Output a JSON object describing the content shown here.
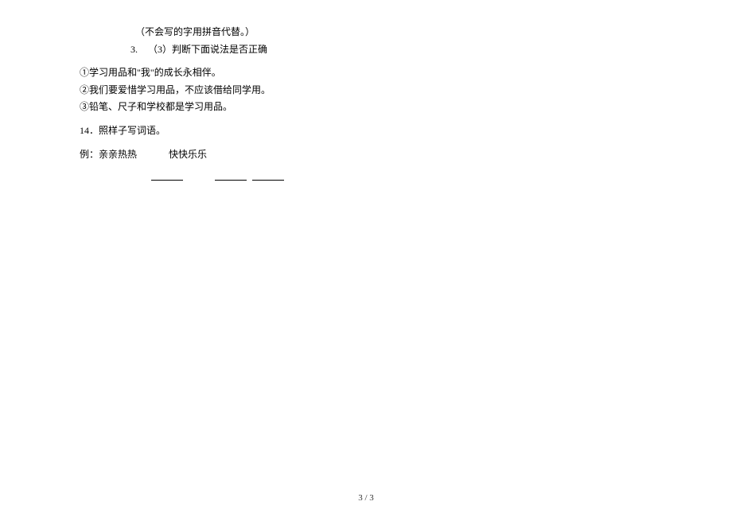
{
  "line_pinyin_note": "（不会写的字用拼音代替。）",
  "sub_item_number": "3.",
  "sub_item_text": "（3）判断下面说法是否正确",
  "statement_1": "①学习用品和\"我\"的成长永相伴。",
  "statement_2": "②我们要爱惜学习用品，不应该借给同学用。",
  "statement_3": "③铅笔、尺子和学校都是学习用品。",
  "question_14": "14．照样子写词语。",
  "example_prefix": "例：",
  "example_word_1": "亲亲热热",
  "example_word_2": "快快乐乐",
  "page_footer": "3 / 3"
}
